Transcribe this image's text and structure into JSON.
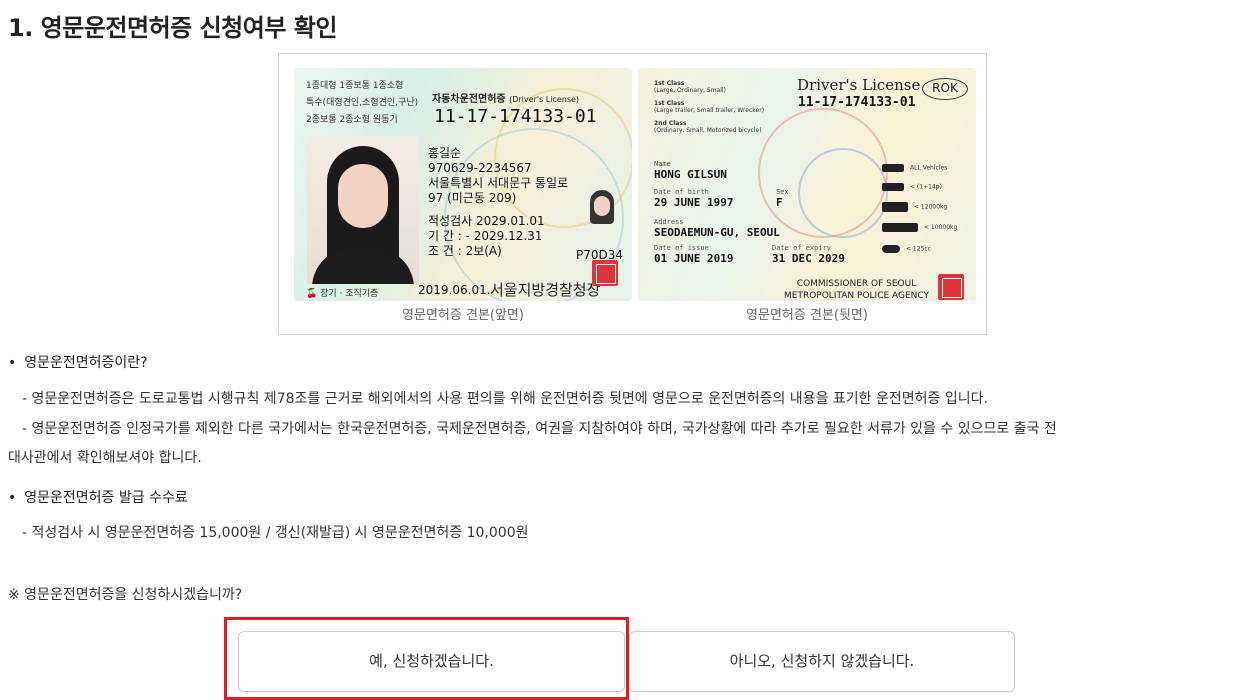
{
  "title": "1. 영문운전면허증 신청여부 확인",
  "front_card": {
    "classes": [
      "1종대형 1종보통 1종소형",
      "특수(대형견인,소형견인,구난)",
      "2종보통 2종소형 원동기"
    ],
    "title": "자동차운전면허증",
    "title_en": "(Driver's License)",
    "number": "11-17-174133-01",
    "name": "홍길순",
    "id": "970629-2234567",
    "address1": "서울특별시 서대문구 통일로",
    "address2": "97 (미근동 209)",
    "exam": "적성검사  2029.01.01",
    "period": "기    간 : - 2029.12.31",
    "condition": "조    건 : 2보(A)",
    "code": "P70D34",
    "date": "2019.06.01.",
    "issuer": "서울지방경찰청장",
    "badge": "장기 · 조직기증",
    "caption": "영문면허증 견본(앞면)"
  },
  "back_card": {
    "title": "Driver's License",
    "country": "ROK",
    "number": "11-17-174133-01",
    "classes": [
      {
        "name": "1st Class",
        "desc": "(Large, Ordinary, Small)"
      },
      {
        "name": "1st Class",
        "desc": "(Large trailer, Small trailer, Wrecker)"
      },
      {
        "name": "2nd Class",
        "desc": "(Ordinary, Small, Motorized bicycle)"
      }
    ],
    "name_label": "Name",
    "name": "HONG GILSUN",
    "dob_label": "Date of birth",
    "dob": "29 JUNE 1997",
    "sex_label": "Sex",
    "sex": "F",
    "address_label": "Address",
    "address": "SEODAEMUN-GU, SEOUL",
    "issue_label": "Date of issue",
    "issue": "01 JUNE 2019",
    "expiry_label": "Date of expiry",
    "expiry": "31 DEC 2029",
    "vehicles": [
      "ALL Vehicles",
      "< (1+14p)",
      "< 12000kg",
      "< 10000kg",
      "< 125cc"
    ],
    "commissioner1": "COMMISSIONER OF SEOUL",
    "commissioner2": "METROPOLITAN POLICE AGENCY",
    "caption": "영문면허증 견본(뒷면)"
  },
  "section1": {
    "heading": "영문운전면허증이란?",
    "line1": "- 영문운전면허증은 도로교통법 시행규칙 제78조를 근거로 해외에서의 사용 편의를 위해 운전면허증 뒷면에 영문으로 운전면허증의 내용을 표기한 운전면허증 입니다.",
    "line2": "- 영문운전면허증 인정국가를 제외한 다른 국가에서는 한국운전면허증, 국제운전면허증, 여권을 지참하여야 하며, 국가상황에 따라 추가로 필요한 서류가 있을 수 있으므로 출국 전",
    "line3": "대사관에서 확인해보셔야 합니다."
  },
  "section2": {
    "heading": "영문운전면허증 발급 수수료",
    "line1": "- 적성검사 시 영문운전면허증 15,000원 / 갱신(재발급) 시 영문운전면허증 10,000원"
  },
  "question": "※ 영문운전면허증을 신청하시겠습니까?",
  "buttons": {
    "yes": "예, 신청하겠습니다.",
    "no": "아니오, 신청하지 않겠습니다."
  },
  "colors": {
    "highlight": "#e21d25",
    "seal": "#e0343b"
  }
}
